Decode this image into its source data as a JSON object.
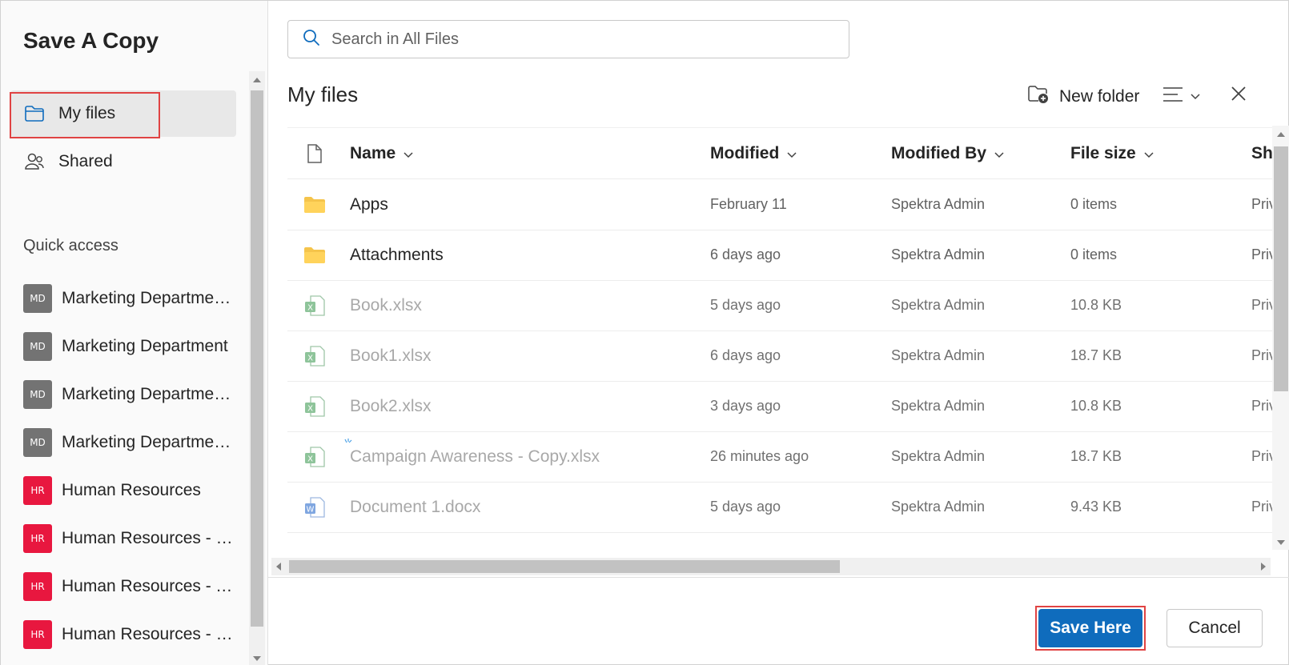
{
  "dialog": {
    "title": "Save A Copy"
  },
  "nav": {
    "items": [
      {
        "label": "My files",
        "icon": "folder-icon",
        "selected": true
      },
      {
        "label": "Shared",
        "icon": "people-icon",
        "selected": false
      }
    ]
  },
  "quick_access": {
    "label": "Quick access",
    "items": [
      {
        "badge": "MD",
        "label": "Marketing Department - Campaigns",
        "color": "#737373"
      },
      {
        "badge": "MD",
        "label": "Marketing Department",
        "color": "#737373"
      },
      {
        "badge": "MD",
        "label": "Marketing Department - Planning",
        "color": "#737373"
      },
      {
        "badge": "MD",
        "label": "Marketing Department - Social",
        "color": "#737373"
      },
      {
        "badge": "HR",
        "label": "Human Resources",
        "color": "#e8173f"
      },
      {
        "badge": "HR",
        "label": "Human Resources - Policies",
        "color": "#e8173f"
      },
      {
        "badge": "HR",
        "label": "Human Resources - Training",
        "color": "#e8173f"
      },
      {
        "badge": "HR",
        "label": "Human Resources - Staffing",
        "color": "#e8173f"
      }
    ]
  },
  "search": {
    "placeholder": "Search in All Files"
  },
  "main": {
    "title": "My files",
    "new_folder_label": "New folder"
  },
  "table": {
    "headers": {
      "name": "Name",
      "modified": "Modified",
      "modified_by": "Modified By",
      "file_size": "File size",
      "sharing": "Sharing"
    },
    "rows": [
      {
        "type": "folder",
        "icon": "folder-icon",
        "name": "Apps",
        "modified": "February 11",
        "modified_by": "Spektra Admin",
        "size": "0 items",
        "sharing": "Private",
        "dim": false
      },
      {
        "type": "folder",
        "icon": "folder-icon",
        "name": "Attachments",
        "modified": "6 days ago",
        "modified_by": "Spektra Admin",
        "size": "0 items",
        "sharing": "Private",
        "dim": false
      },
      {
        "type": "excel",
        "icon": "excel-icon",
        "name": "Book.xlsx",
        "modified": "5 days ago",
        "modified_by": "Spektra Admin",
        "size": "10.8 KB",
        "sharing": "Private",
        "dim": true
      },
      {
        "type": "excel",
        "icon": "excel-icon",
        "name": "Book1.xlsx",
        "modified": "6 days ago",
        "modified_by": "Spektra Admin",
        "size": "18.7 KB",
        "sharing": "Private",
        "dim": true
      },
      {
        "type": "excel",
        "icon": "excel-icon",
        "name": "Book2.xlsx",
        "modified": "3 days ago",
        "modified_by": "Spektra Admin",
        "size": "10.8 KB",
        "sharing": "Private",
        "dim": true
      },
      {
        "type": "excel",
        "icon": "excel-icon",
        "name": "Campaign Awareness - Copy.xlsx",
        "modified": "26 minutes ago",
        "modified_by": "Spektra Admin",
        "size": "18.7 KB",
        "sharing": "Private",
        "dim": true
      },
      {
        "type": "word",
        "icon": "word-icon",
        "name": "Document 1.docx",
        "modified": "5 days ago",
        "modified_by": "Spektra Admin",
        "size": "9.43 KB",
        "sharing": "Private",
        "dim": true
      }
    ]
  },
  "footer": {
    "save_label": "Save Here",
    "cancel_label": "Cancel"
  },
  "colors": {
    "accent": "#0f6cbd",
    "highlight": "#e04343",
    "folder": "#f5c44b"
  }
}
